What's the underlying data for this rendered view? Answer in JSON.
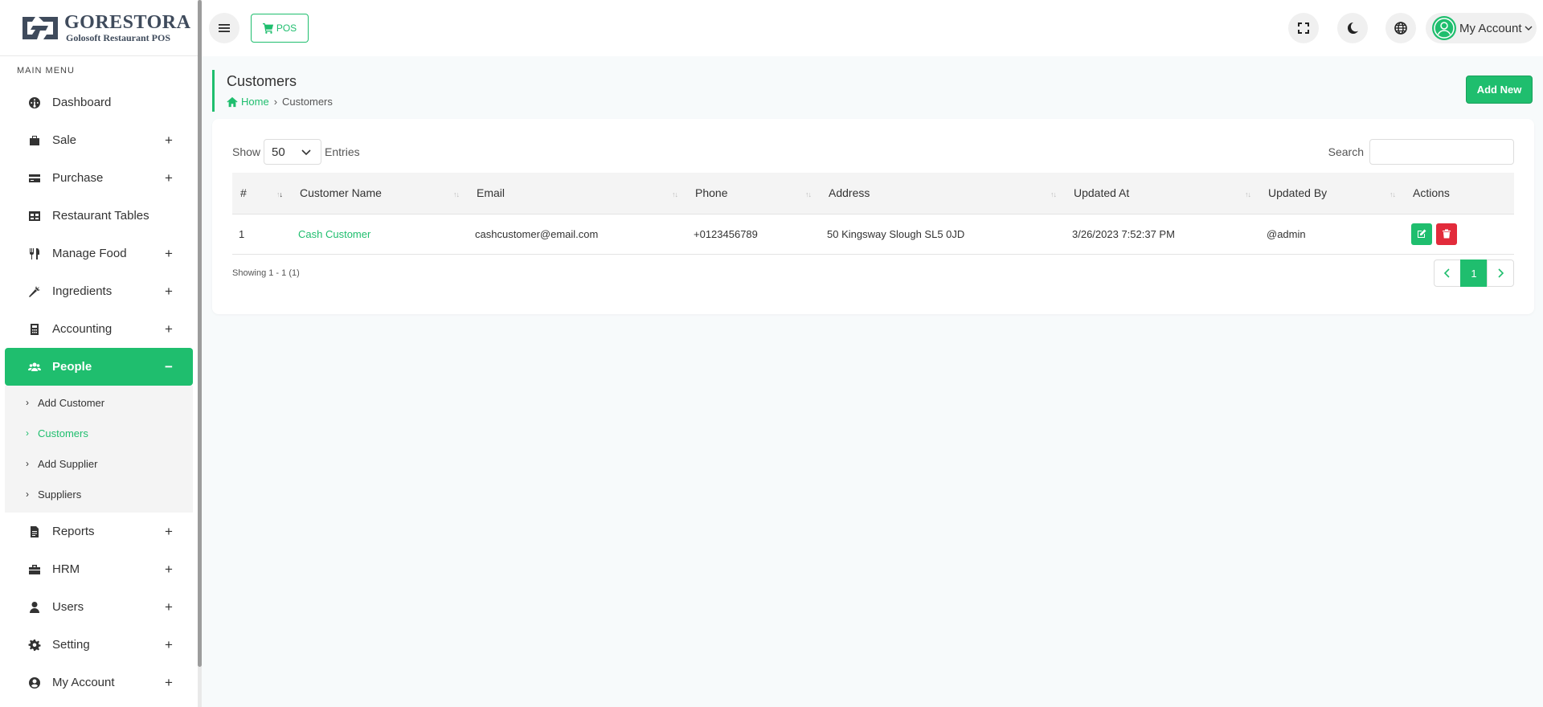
{
  "brand": {
    "name": "GORESTORA",
    "tagline": "Golosoft Restaurant POS"
  },
  "sidebar": {
    "heading": "MAIN MENU",
    "items": [
      {
        "label": "Dashboard",
        "icon": "dashboard-icon",
        "expandable": ""
      },
      {
        "label": "Sale",
        "icon": "sale-icon",
        "expandable": "+"
      },
      {
        "label": "Purchase",
        "icon": "credit-card-icon",
        "expandable": "+"
      },
      {
        "label": "Restaurant Tables",
        "icon": "table-icon",
        "expandable": ""
      },
      {
        "label": "Manage Food",
        "icon": "utensils-icon",
        "expandable": "+"
      },
      {
        "label": "Ingredients",
        "icon": "carrot-icon",
        "expandable": "+"
      },
      {
        "label": "Accounting",
        "icon": "calculator-icon",
        "expandable": "+"
      },
      {
        "label": "People",
        "icon": "users-icon",
        "expandable": "−"
      },
      {
        "label": "Reports",
        "icon": "file-icon",
        "expandable": "+"
      },
      {
        "label": "HRM",
        "icon": "briefcase-icon",
        "expandable": "+"
      },
      {
        "label": "Users",
        "icon": "user-icon",
        "expandable": "+"
      },
      {
        "label": "Setting",
        "icon": "gear-icon",
        "expandable": "+"
      },
      {
        "label": "My Account",
        "icon": "user-circle-icon",
        "expandable": "+"
      }
    ],
    "people_submenu": [
      "Add Customer",
      "Customers",
      "Add Supplier",
      "Suppliers"
    ]
  },
  "topbar": {
    "pos_label": "POS",
    "account_label": "My Account"
  },
  "page": {
    "title": "Customers",
    "breadcrumb_home": "Home",
    "breadcrumb_current": "Customers",
    "add_new_label": "Add New"
  },
  "table_controls": {
    "show_label": "Show",
    "entries_value": "50",
    "entries_label": "Entries",
    "search_label": "Search"
  },
  "table": {
    "headers": [
      "#",
      "Customer Name",
      "Email",
      "Phone",
      "Address",
      "Updated At",
      "Updated By",
      "Actions"
    ],
    "rows": [
      {
        "num": "1",
        "name": "Cash Customer",
        "email": "cashcustomer@email.com",
        "phone": "+0123456789",
        "address": "50 Kingsway Slough SL5 0JD",
        "updated_at": "3/26/2023 7:52:37 PM",
        "updated_by": "@admin"
      }
    ]
  },
  "footer": {
    "showing": "Showing 1 - 1 (1)",
    "current_page": "1"
  },
  "colors": {
    "accent": "#1fbe6e",
    "danger": "#e22b3b"
  }
}
